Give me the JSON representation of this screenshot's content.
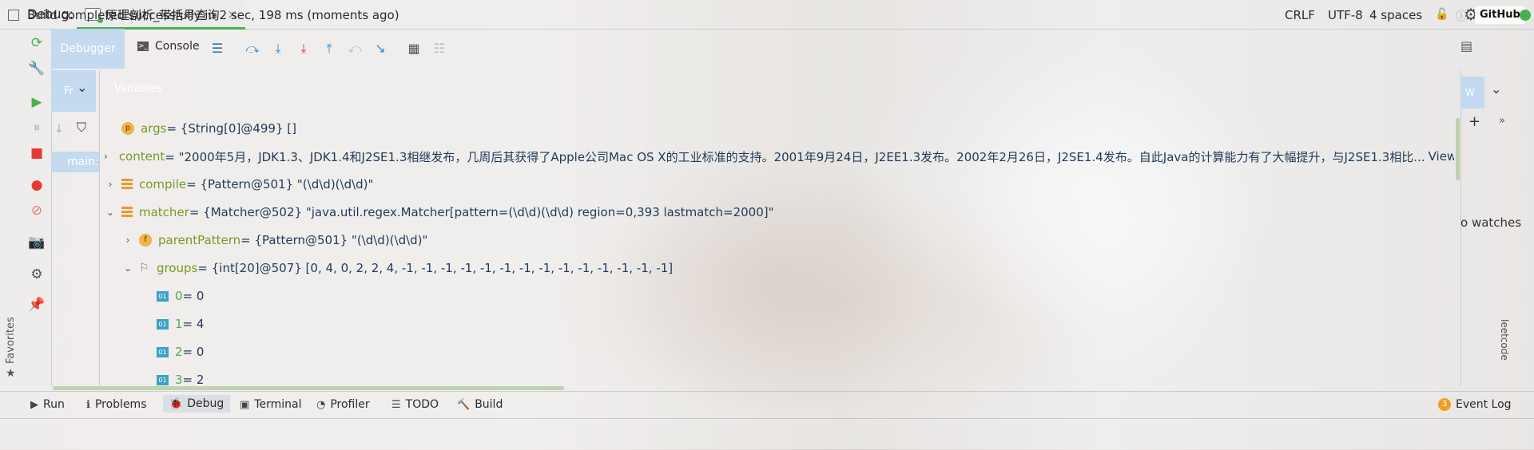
{
  "window": {
    "debug_label": "Debug:",
    "session_tab": "原理剖析_带括号查询",
    "close_glyph": "×"
  },
  "toolbar": {
    "debugger_tab": "Debugger",
    "console_tab": "Console"
  },
  "panels": {
    "frames_tab": "Fr",
    "variables_header": "Variables",
    "thread": "main:",
    "watches_tab": "W",
    "no_watches": "o watches",
    "leetcode": "leetcode"
  },
  "variables": [
    {
      "indent": 0,
      "expander": "",
      "icon": "p",
      "name": "args",
      "value": "= {String[0]@499} []"
    },
    {
      "indent": 0,
      "expander": "collapsed",
      "icon": "field",
      "name": "content",
      "value": "= \"2000年5月，JDK1.3、JDK1.4和J2SE1.3相继发布，几周后其获得了Apple公司Mac OS X的工业标准的支持。2001年9月24日，J2EE1.3发布。2002年2月26日，J2SE1.4发布。自此Java的计算能力有了大幅提升，与J2SE1.3相比...",
      "link": "View"
    },
    {
      "indent": 0,
      "expander": "collapsed",
      "icon": "field",
      "name": "compile",
      "value": "= {Pattern@501} \"(\\d\\d)(\\d\\d)\""
    },
    {
      "indent": 0,
      "expander": "expanded",
      "icon": "field",
      "name": "matcher",
      "value": "= {Matcher@502} \"java.util.regex.Matcher[pattern=(\\d\\d)(\\d\\d) region=0,393 lastmatch=2000]\""
    },
    {
      "indent": 1,
      "expander": "collapsed",
      "icon": "f",
      "name": "parentPattern",
      "value": "= {Pattern@501} \"(\\d\\d)(\\d\\d)\""
    },
    {
      "indent": 1,
      "expander": "expanded",
      "icon": "array",
      "name": "groups",
      "value": "= {int[20]@507} [0, 4, 0, 2, 2, 4, -1, -1, -1, -1, -1, -1, -1, -1, -1, -1, -1, -1, -1, -1]"
    },
    {
      "indent": 2,
      "expander": "",
      "icon": "01",
      "name": "0",
      "value": "= 0"
    },
    {
      "indent": 2,
      "expander": "",
      "icon": "01",
      "name": "1",
      "value": "= 4"
    },
    {
      "indent": 2,
      "expander": "",
      "icon": "01",
      "name": "2",
      "value": "= 0"
    },
    {
      "indent": 2,
      "expander": "",
      "icon": "01",
      "name": "3",
      "value": "= 2"
    }
  ],
  "tool_windows": [
    "Run",
    "Problems",
    "Debug",
    "Terminal",
    "Profiler",
    "TODO",
    "Build"
  ],
  "event_log": {
    "count": "3",
    "label": "Event Log"
  },
  "status": {
    "message": "Build completed successfully in 2 sec, 198 ms (moments ago)",
    "line_sep": "CRLF",
    "encoding": "UTF-8",
    "indent": "4 spaces",
    "vcs": "GitHub"
  },
  "colors": {
    "accent": "#4caf50",
    "selected_tab": "#bed7f0",
    "field_icon": "#e89b2c"
  }
}
